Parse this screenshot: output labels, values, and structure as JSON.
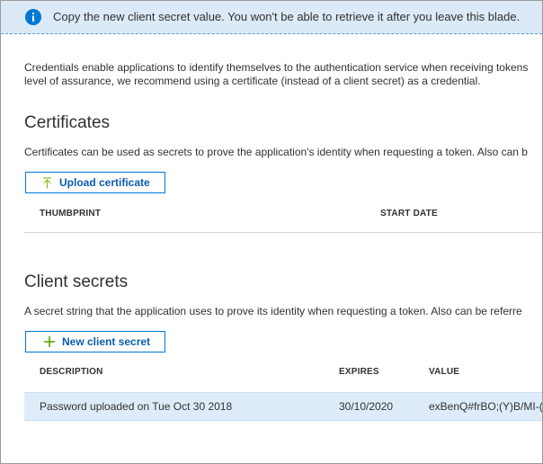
{
  "banner": {
    "icon": "info-icon",
    "text": "Copy the new client secret value. You won't be able to retrieve it after you leave this blade."
  },
  "intro": {
    "line1": "Credentials enable applications to identify themselves to the authentication service when receiving tokens",
    "line2": "level of assurance, we recommend using a certificate (instead of a client secret) as a credential."
  },
  "certificates": {
    "title": "Certificates",
    "description": "Certificates can be used as secrets to prove the application's identity when requesting a token. Also can b",
    "upload_button": "Upload certificate",
    "upload_icon": "upload-icon",
    "columns": [
      "THUMBPRINT",
      "START DATE"
    ]
  },
  "client_secrets": {
    "title": "Client secrets",
    "description": "A secret string that the application uses to prove its identity when requesting a token. Also can be referre",
    "new_button": "New client secret",
    "new_icon": "plus-icon",
    "columns": [
      "DESCRIPTION",
      "EXPIRES",
      "VALUE"
    ],
    "rows": [
      {
        "description": "Password uploaded on Tue Oct 30 2018",
        "expires": "30/10/2020",
        "value": "exBenQ#frBO;(Y)B/MI-("
      }
    ]
  },
  "colors": {
    "banner_bg": "#dce9f7",
    "accent": "#0078d4",
    "selected_row": "#deecf9",
    "upload_arrow": "#8cbd18",
    "plus_icon": "#57a300"
  }
}
